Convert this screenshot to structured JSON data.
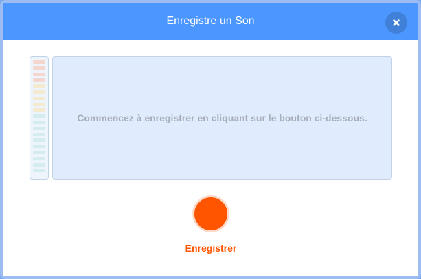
{
  "modal": {
    "title": "Enregistre un Son",
    "close_icon": "close-icon"
  },
  "meter": {
    "bar_count": 19,
    "active_level": 0,
    "colors": {
      "top": "#f5d6cf",
      "middle": "#f3ead0",
      "bottom": "#d5ecec"
    }
  },
  "waveform": {
    "instructions": "Commencez à enregistrer en cliquant sur le bouton ci-dessous."
  },
  "record": {
    "label": "Enregistrer",
    "color": "#ff5500"
  },
  "colors": {
    "header": "#4c97ff",
    "panel_bg": "#e0ecfd",
    "muted_text": "#a7adb8"
  }
}
